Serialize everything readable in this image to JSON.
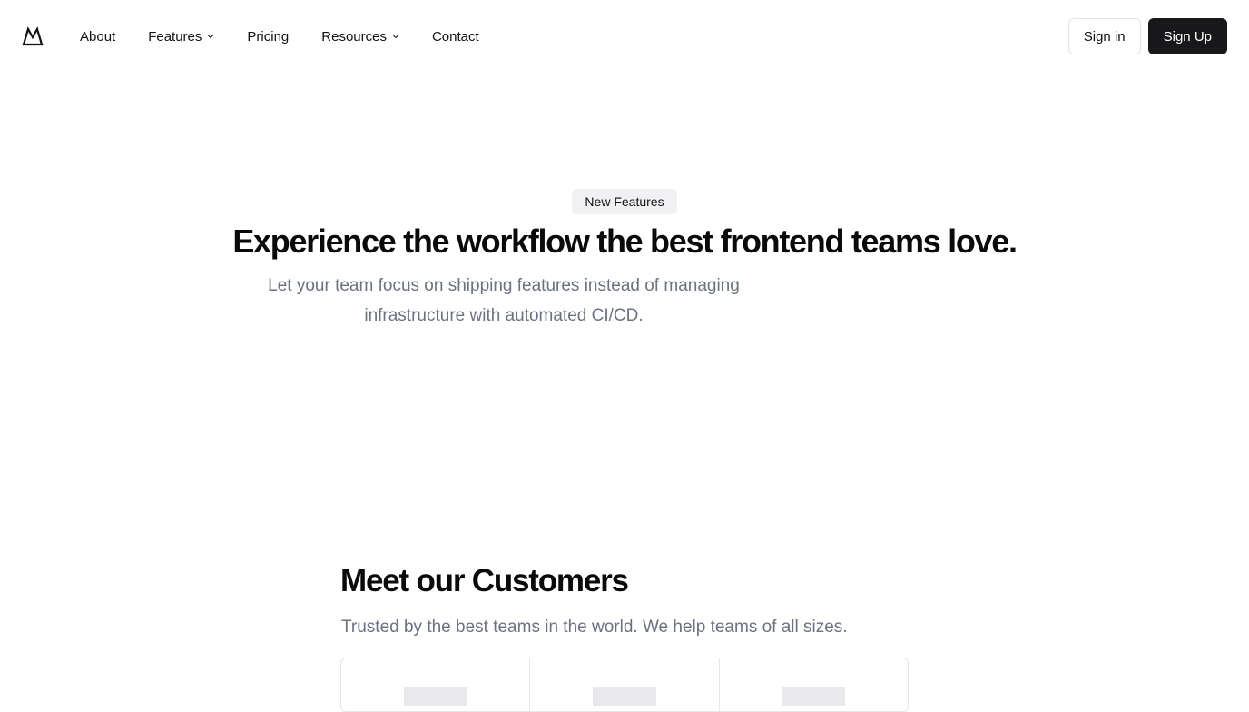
{
  "header": {
    "logo_icon": "mountain-logo-icon",
    "nav": [
      {
        "label": "About",
        "has_dropdown": false
      },
      {
        "label": "Features",
        "has_dropdown": true
      },
      {
        "label": "Pricing",
        "has_dropdown": false
      },
      {
        "label": "Resources",
        "has_dropdown": true
      },
      {
        "label": "Contact",
        "has_dropdown": false
      }
    ],
    "sign_in_label": "Sign in",
    "sign_up_label": "Sign Up"
  },
  "hero": {
    "badge": "New Features",
    "title": "Experience the workflow the best frontend teams love.",
    "subtitle": "Let your team focus on shipping features instead of managing infrastructure with automated CI/CD."
  },
  "customers": {
    "title": "Meet our Customers",
    "subtitle": "Trusted by the best teams in the world. We help teams of all sizes.",
    "logo_count": 3
  },
  "colors": {
    "primary_button": "#18181b",
    "muted_text": "#6b7280",
    "badge_bg": "#f1f1f3",
    "border": "#e5e7eb"
  }
}
